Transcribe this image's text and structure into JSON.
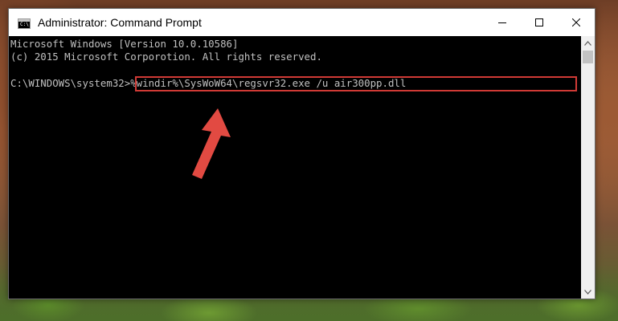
{
  "window": {
    "title": "Administrator: Command Prompt",
    "icon": "cmd-icon",
    "icon_glyph": "C:\\",
    "controls": [
      "minimize-icon",
      "maximize-icon",
      "close-icon"
    ]
  },
  "console": {
    "lines": [
      "Microsoft Windows [Version 10.0.10586]",
      "(c) 2015 Microsoft Corporotion. All rights reserved.",
      "",
      "C:\\WINDOWS\\system32>%windir%\\SysWoW64\\regsvr32.exe /u air300pp.dll"
    ],
    "prompt": "C:\\WINDOWS\\system32>",
    "command": "%windir%\\SysWoW64\\regsvr32.exe /u air300pp.dll"
  },
  "annotation": {
    "highlight_color": "#d03a35",
    "arrow_color": "#e24a42"
  },
  "colors": {
    "console_bg": "#000000",
    "console_text": "#c0c0c0"
  }
}
